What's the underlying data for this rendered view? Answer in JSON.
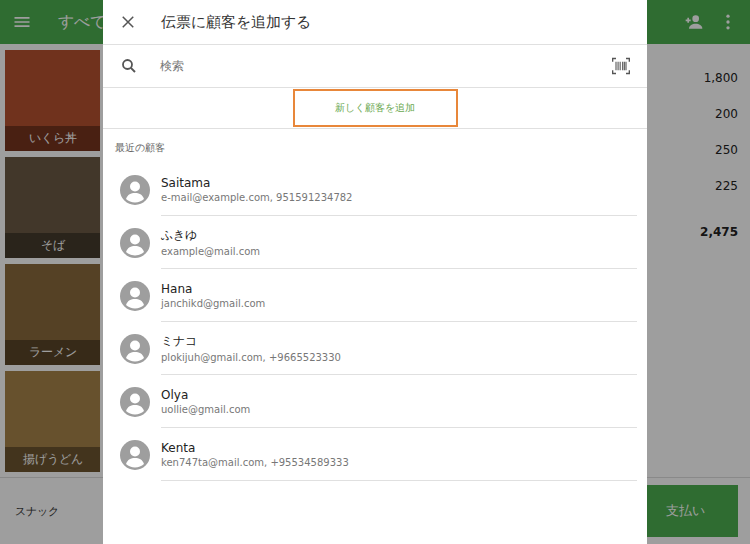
{
  "app": {
    "header_title": "すべて",
    "products": [
      {
        "name": "いくら丼",
        "color": "#b5512f"
      },
      {
        "name": "そば",
        "color": "#6b5a45"
      },
      {
        "name": "ラーメン",
        "color": "#8a6a3c"
      },
      {
        "name": "揚げうどん",
        "color": "#a7834a"
      }
    ],
    "ticket_prices": [
      "1,800",
      "200",
      "250",
      "225"
    ],
    "ticket_total": "2,475",
    "category_tab": "スナック",
    "pay_button": "支払い"
  },
  "dialog": {
    "title": "伝票に顧客を追加する",
    "search": {
      "placeholder": "検索"
    },
    "add_button": {
      "label": "新しく顧客を追加",
      "highlighted": true
    },
    "section_label": "最近の顧客",
    "customers": [
      {
        "name": "Saitama",
        "detail": "e-mail@example.com, 951591234782"
      },
      {
        "name": "ふきゆ",
        "detail": "example@mail.com"
      },
      {
        "name": "Hana",
        "detail": "janchikd@gmail.com"
      },
      {
        "name": "ミナコ",
        "detail": "plokijuh@gmail.com, +9665523330"
      },
      {
        "name": "Olya",
        "detail": "uollie@gmail.com"
      },
      {
        "name": "Kenta",
        "detail": "ken747ta@mail.com, +95534589333"
      }
    ]
  }
}
